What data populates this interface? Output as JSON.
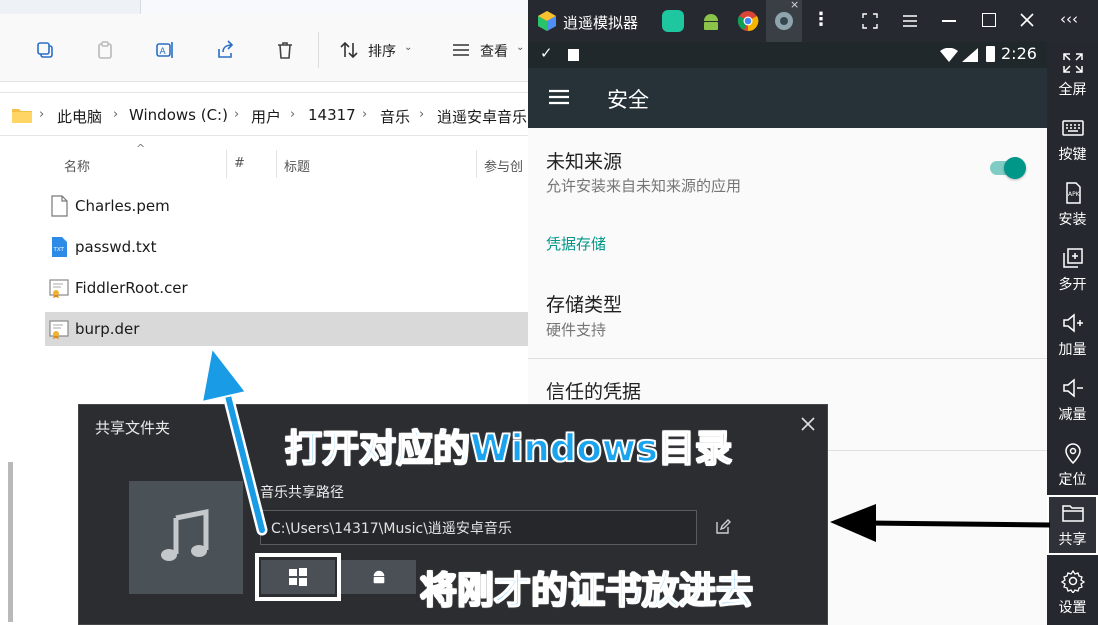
{
  "explorer": {
    "toolbar": {
      "sort_label": "排序",
      "view_label": "查看"
    },
    "breadcrumb": [
      "此电脑",
      "Windows (C:)",
      "用户",
      "14317",
      "音乐",
      "逍遥安卓音乐"
    ],
    "columns": [
      "名称",
      "#",
      "标题",
      "参与创"
    ],
    "files": [
      {
        "name": "Charles.pem",
        "icon": "document-icon",
        "selected": false
      },
      {
        "name": "passwd.txt",
        "icon": "txt-file-icon",
        "selected": false
      },
      {
        "name": "FiddlerRoot.cer",
        "icon": "certificate-icon",
        "selected": false
      },
      {
        "name": "burp.der",
        "icon": "certificate-icon",
        "selected": true
      }
    ]
  },
  "emulator": {
    "title": "逍遥模拟器",
    "tabs": [
      "app-icon",
      "android-icon",
      "chrome-icon",
      "settings-icon"
    ],
    "status": {
      "time": "2:26"
    },
    "appbar_title": "安全",
    "settings": {
      "unknown_sources_title": "未知来源",
      "unknown_sources_sub": "允许安装来自未知来源的应用",
      "unknown_sources_on": true,
      "section_header": "凭据存储",
      "storage_type_title": "存储类型",
      "storage_type_sub": "硬件支持",
      "trusted_title": "信任的凭据"
    },
    "sidebar": [
      {
        "label": "全屏",
        "icon": "fullscreen-icon"
      },
      {
        "label": "按键",
        "icon": "keyboard-icon"
      },
      {
        "label": "安装",
        "icon": "apk-icon"
      },
      {
        "label": "多开",
        "icon": "multi-open-icon"
      },
      {
        "label": "加量",
        "icon": "volume-up-icon"
      },
      {
        "label": "减量",
        "icon": "volume-down-icon"
      },
      {
        "label": "定位",
        "icon": "location-icon"
      },
      {
        "label": "共享",
        "icon": "folder-icon"
      },
      {
        "label": "设置",
        "icon": "gear-icon"
      }
    ],
    "colors": {
      "teal_accent": "#009688",
      "appbar": "#263238"
    }
  },
  "dialog": {
    "title": "共享文件夹",
    "path_label": "音乐共享路径",
    "path_value": "C:\\Users\\14317\\Music\\逍遥安卓音乐"
  },
  "annotations": {
    "top": "打开对应的Windows目录",
    "bottom": "将刚才的证书放进去"
  }
}
